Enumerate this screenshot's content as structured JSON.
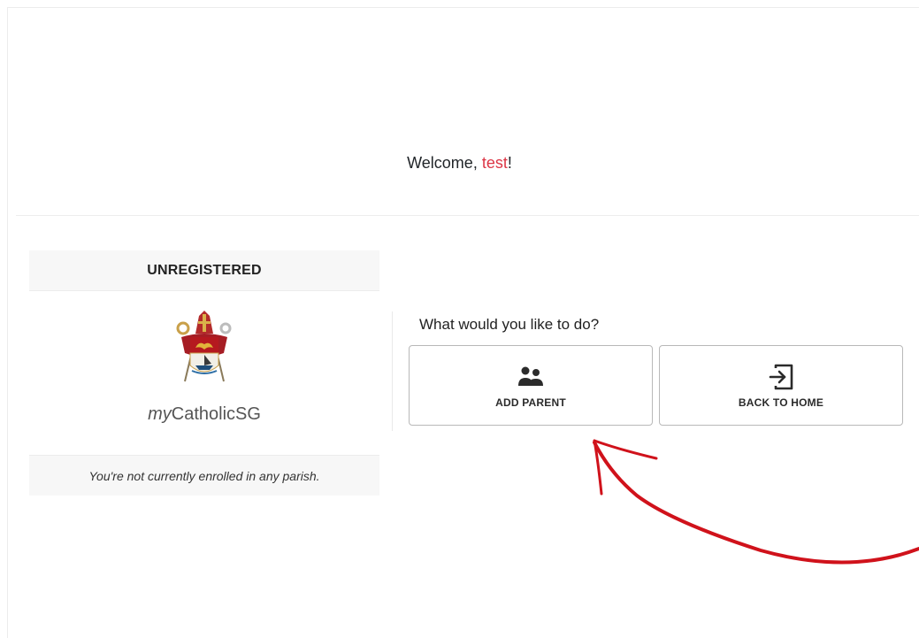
{
  "welcome": {
    "prefix": "Welcome, ",
    "username": "test",
    "suffix": "!"
  },
  "status_card": {
    "header": "UNREGISTERED",
    "brand_prefix": "my",
    "brand_suffix": "CatholicSG",
    "footer": "You're not currently enrolled in any parish."
  },
  "actions": {
    "prompt": "What would you like to do?",
    "add_parent": {
      "label": "ADD PARENT",
      "icon": "users-icon"
    },
    "back_home": {
      "label": "BACK TO HOME",
      "icon": "sign-in-icon"
    }
  },
  "colors": {
    "accent": "#dc3545",
    "annotation_arrow": "#d0121b",
    "card_header_bg": "#f7f7f7",
    "button_border": "#b8b8b8"
  }
}
